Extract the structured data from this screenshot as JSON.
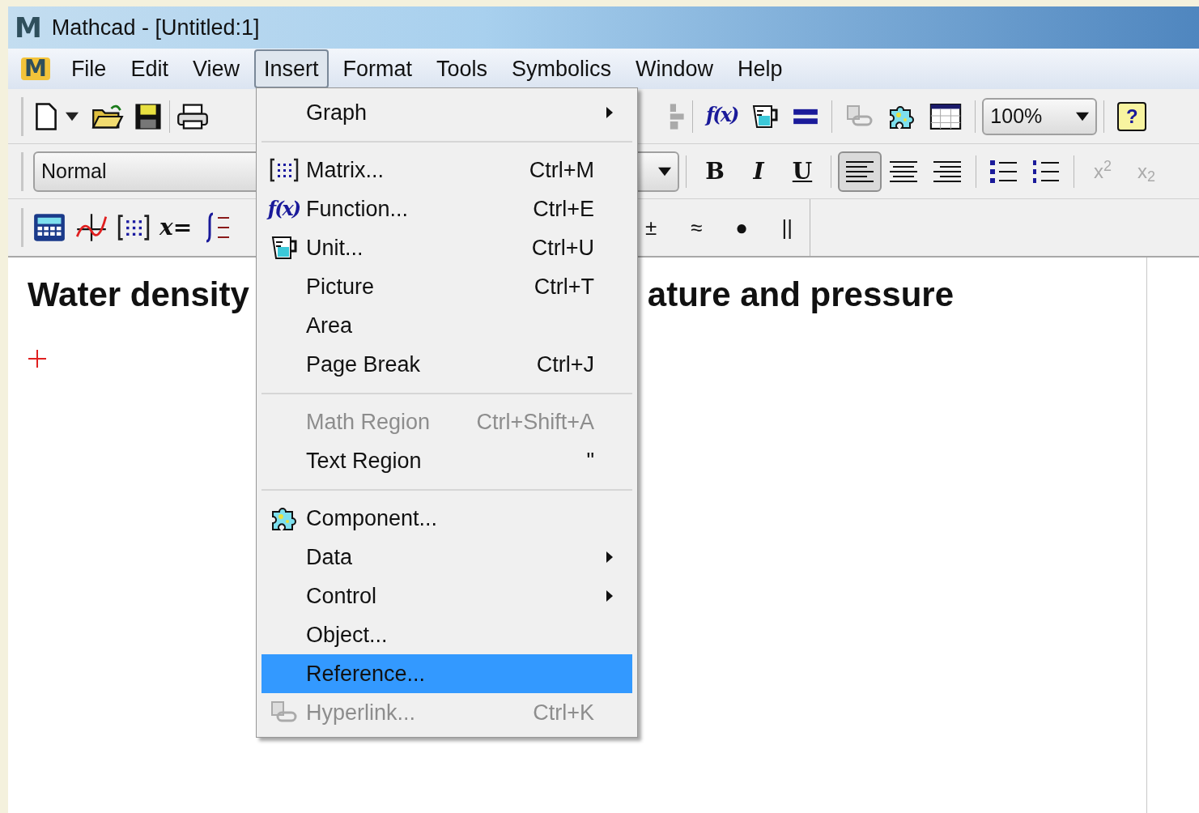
{
  "window": {
    "app_icon_text": "M",
    "title": "Mathcad - [Untitled:1]"
  },
  "menu_bar": {
    "icon_text": "M",
    "items": [
      {
        "label": "File",
        "selected": false
      },
      {
        "label": "Edit",
        "selected": false
      },
      {
        "label": "View",
        "selected": false
      },
      {
        "label": "Insert",
        "selected": true
      },
      {
        "label": "Format",
        "selected": false
      },
      {
        "label": "Tools",
        "selected": false
      },
      {
        "label": "Symbolics",
        "selected": false
      },
      {
        "label": "Window",
        "selected": false
      },
      {
        "label": "Help",
        "selected": false
      }
    ]
  },
  "standard_toolbar": {
    "function_icon_text": "f(x)",
    "zoom": "100%",
    "help_label": "?"
  },
  "formatting_toolbar": {
    "style": "Normal",
    "text_buttons": [
      "B",
      "I",
      "U"
    ],
    "alignment": [
      {
        "selected": true
      },
      {
        "selected": false
      },
      {
        "selected": false
      }
    ],
    "script_buttons": [
      {
        "label": "x$^{2}$",
        "disabled": true
      },
      {
        "label": "x$_{2}$",
        "disabled": true
      }
    ]
  },
  "math_toolbar": {
    "evaluate_label": "x=",
    "buttons": [
      "±",
      "≈",
      "●",
      "||"
    ]
  },
  "document": {
    "heading_left": "Water density",
    "heading_right": "ature and pressure"
  },
  "insert_menu": [
    {
      "kind": "item",
      "label": "Graph",
      "submenu": true,
      "disabled": false,
      "selected": false
    },
    {
      "kind": "separator"
    },
    {
      "kind": "item",
      "label": "Matrix...",
      "shortcut": "Ctrl+M",
      "submenu": false,
      "disabled": false,
      "selected": false
    },
    {
      "kind": "item",
      "label": "Function...",
      "shortcut": "Ctrl+E",
      "submenu": false,
      "disabled": false,
      "selected": false,
      "icon_text": "f(x)"
    },
    {
      "kind": "item",
      "label": "Unit...",
      "shortcut": "Ctrl+U",
      "submenu": false,
      "disabled": false,
      "selected": false
    },
    {
      "kind": "item",
      "label": "Picture",
      "shortcut": "Ctrl+T",
      "submenu": false,
      "disabled": false,
      "selected": false
    },
    {
      "kind": "item",
      "label": "Area",
      "submenu": false,
      "disabled": false,
      "selected": false
    },
    {
      "kind": "item",
      "label": "Page Break",
      "shortcut": "Ctrl+J",
      "submenu": false,
      "disabled": false,
      "selected": false
    },
    {
      "kind": "separator"
    },
    {
      "kind": "item",
      "label": "Math Region",
      "shortcut": "Ctrl+Shift+A",
      "submenu": false,
      "disabled": true,
      "selected": false
    },
    {
      "kind": "item",
      "label": "Text Region",
      "shortcut": "\"",
      "submenu": false,
      "disabled": false,
      "selected": false
    },
    {
      "kind": "separator"
    },
    {
      "kind": "item",
      "label": "Component...",
      "submenu": false,
      "disabled": false,
      "selected": false
    },
    {
      "kind": "item",
      "label": "Data",
      "submenu": true,
      "disabled": false,
      "selected": false
    },
    {
      "kind": "item",
      "label": "Control",
      "submenu": true,
      "disabled": false,
      "selected": false
    },
    {
      "kind": "item",
      "label": "Object...",
      "submenu": false,
      "disabled": false,
      "selected": false
    },
    {
      "kind": "item",
      "label": "Reference...",
      "submenu": false,
      "disabled": false,
      "selected": true
    },
    {
      "kind": "item",
      "label": "Hyperlink...",
      "shortcut": "Ctrl+K",
      "submenu": false,
      "disabled": true,
      "selected": false
    }
  ]
}
